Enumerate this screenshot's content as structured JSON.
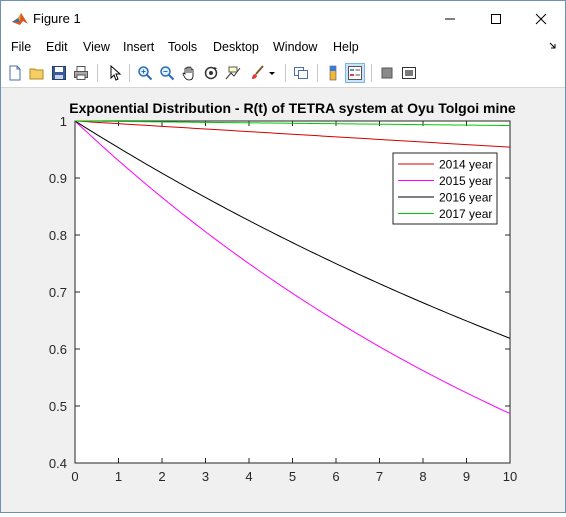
{
  "window": {
    "title": "Figure 1"
  },
  "menu": [
    "File",
    "Edit",
    "View",
    "Insert",
    "Tools",
    "Desktop",
    "Window",
    "Help"
  ],
  "toolbar": {
    "icons": [
      "new-figure-icon",
      "open-folder-icon",
      "save-icon",
      "print-icon",
      "arrow-cursor-icon",
      "zoom-in-icon",
      "zoom-out-icon",
      "pan-hand-icon",
      "rotate-3d-icon",
      "data-cursor-icon",
      "brush-icon",
      "dropdown-caret-icon",
      "link-plot-icon",
      "colorbar-icon",
      "legend-icon",
      "hide-plot-tools-icon",
      "show-plot-tools-icon"
    ]
  },
  "chart_data": {
    "type": "line",
    "title": "Exponential Distribution - R(t) of TETRA system at Oyu Tolgoi mine",
    "xlabel": "",
    "ylabel": "",
    "xlim": [
      0,
      10
    ],
    "ylim": [
      0.4,
      1
    ],
    "xticks": [
      "0",
      "1",
      "2",
      "3",
      "4",
      "5",
      "6",
      "7",
      "8",
      "9",
      "10"
    ],
    "yticks": [
      "0.4",
      "0.5",
      "0.6",
      "0.7",
      "0.8",
      "0.9",
      "1"
    ],
    "grid": false,
    "legend_position": "top-right",
    "series": [
      {
        "name": "2014 year",
        "color": "#d40000",
        "x": [
          0,
          10
        ],
        "rate": 0.0047,
        "end_value": 0.955
      },
      {
        "name": "2015 year",
        "color": "#ff00ff",
        "x": [
          0,
          10
        ],
        "rate": 0.072,
        "end_value": 0.487
      },
      {
        "name": "2016 year",
        "color": "#000000",
        "x": [
          0,
          10
        ],
        "rate": 0.048,
        "end_value": 0.619
      },
      {
        "name": "2017 year",
        "color": "#00cc00",
        "x": [
          0,
          10
        ],
        "rate": 0.0008,
        "end_value": 0.992
      }
    ]
  }
}
